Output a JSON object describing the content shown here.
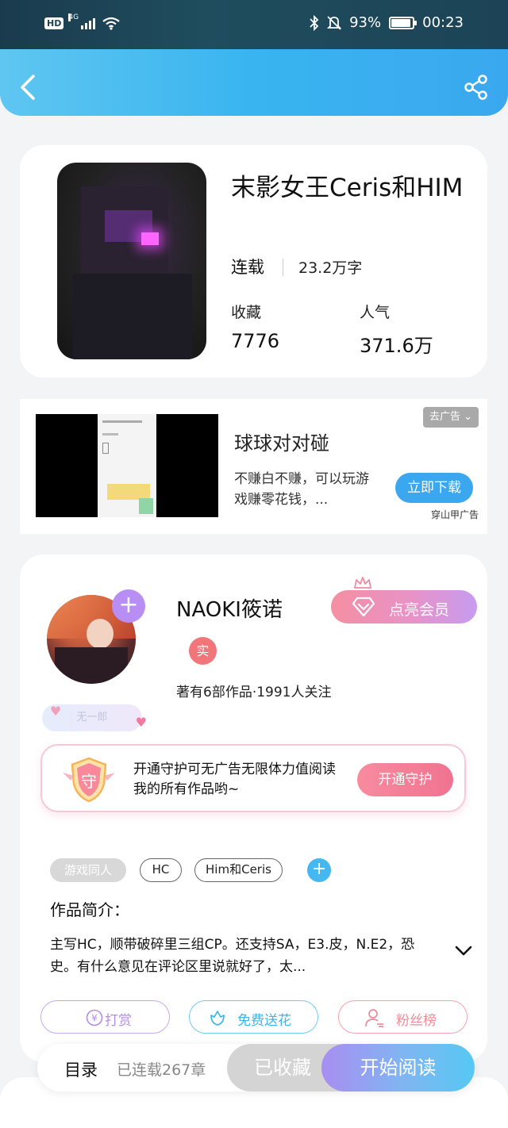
{
  "status_bar": {
    "hd": "HD",
    "network": "4G",
    "battery_percent": "93%",
    "battery_level": 0.93,
    "time": "00:23"
  },
  "header": {
    "back_icon": "chevron-left-icon",
    "share_icon": "share-icon"
  },
  "book": {
    "title": "末影女王Ceris和HIM",
    "status": "连载",
    "word_count": "23.2万字",
    "favorites_label": "收藏",
    "favorites_value": "7776",
    "popularity_label": "人气",
    "popularity_value": "371.6万"
  },
  "ad": {
    "remove_label": "去广告",
    "app_name": "球球对对碰",
    "description": "不赚白不赚，可以玩游戏赚零花钱，...",
    "download_label": "立即下载",
    "source": "穿山甲广告"
  },
  "author": {
    "name": "NAOKI筱诺",
    "vip_button": "点亮会员",
    "real_badge": "实",
    "stats": "著有6部作品·1991人关注",
    "rank": "无一郎",
    "guard_icon_text": "守",
    "guard_text": "开通守护可无广告无限体力值阅读我的所有作品哟~",
    "guard_button": "开通守护"
  },
  "tags": [
    "游戏同人",
    "HC",
    "Him和Ceris"
  ],
  "intro": {
    "title": "作品简介：",
    "text": "主写HC，顺带破碎里三组CP。还支持SA，E3.皮，N.E2，恐史。有什么意见在评论区里说就好了，太..."
  },
  "actions": {
    "reward": "打赏",
    "reward_icon": "yen-coin-icon",
    "flower": "免费送花",
    "flower_icon": "flower-icon",
    "fans": "粉丝榜",
    "fans_icon": "user-rank-icon"
  },
  "bottom_bar": {
    "toc": "目录",
    "chapters": "已连载267章",
    "favorited": "已收藏",
    "start_reading": "开始阅读"
  },
  "colors": {
    "header_gradient_start": "#5fc6f1",
    "header_gradient_end": "#3aa8ef",
    "vip_pink": "#f58fa2",
    "vip_purple": "#c79cf0",
    "download_blue": "#3aa7ef",
    "real_badge": "#f0767a",
    "plus_badge": "#b88ef4"
  }
}
